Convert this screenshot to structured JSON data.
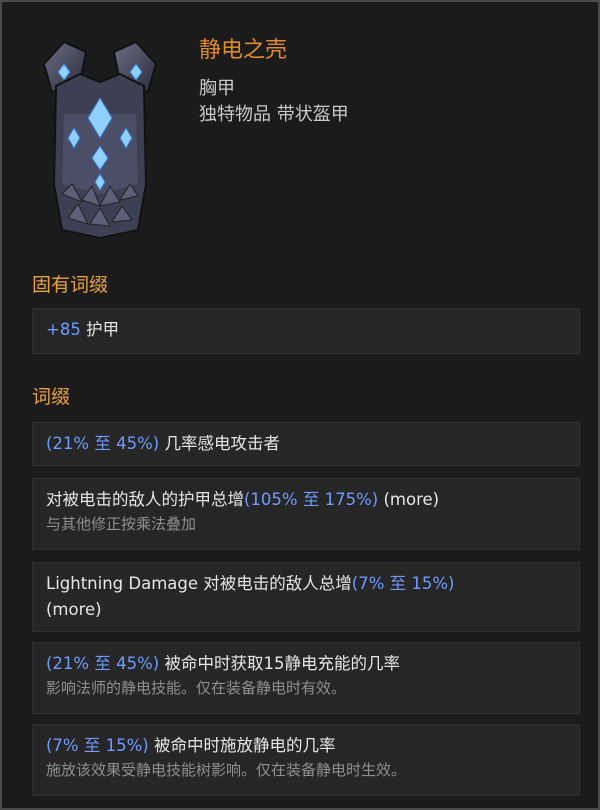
{
  "item": {
    "name": "静电之壳",
    "slot": "胸甲",
    "rarity_type": "独特物品 带状盔甲"
  },
  "implicit": {
    "heading": "固有词缀",
    "armor_value": "+85",
    "armor_label": "护甲"
  },
  "affixes": {
    "heading": "词缀",
    "a1": {
      "range": "(21% 至 45%)",
      "text": "几率感电攻击者"
    },
    "a2": {
      "text": "对被电击的敌人的护甲总增",
      "range": "(105% 至 175%)",
      "tag": "(more)",
      "note": "与其他修正按乘法叠加"
    },
    "a3": {
      "text": "Lightning Damage 对被电击的敌人总增",
      "range": "(7% 至 15%)",
      "tag": "(more)"
    },
    "a4": {
      "range": "(21% 至 45%)",
      "text": "被命中时获取15静电充能的几率",
      "note": "影响法师的静电技能。仅在装备静电时有效。"
    },
    "a5": {
      "range": "(7% 至 15%)",
      "text": "被命中时施放静电的几率",
      "note": "施放该效果受静电技能树影响。仅在装备静电时生效。"
    }
  },
  "colors": {
    "title": "#e08a2e",
    "heading": "#e8a040",
    "range": "#6e9bff",
    "text": "#e6e6e6",
    "note": "#8f8f8f"
  },
  "icon": "chest-armor-icon"
}
